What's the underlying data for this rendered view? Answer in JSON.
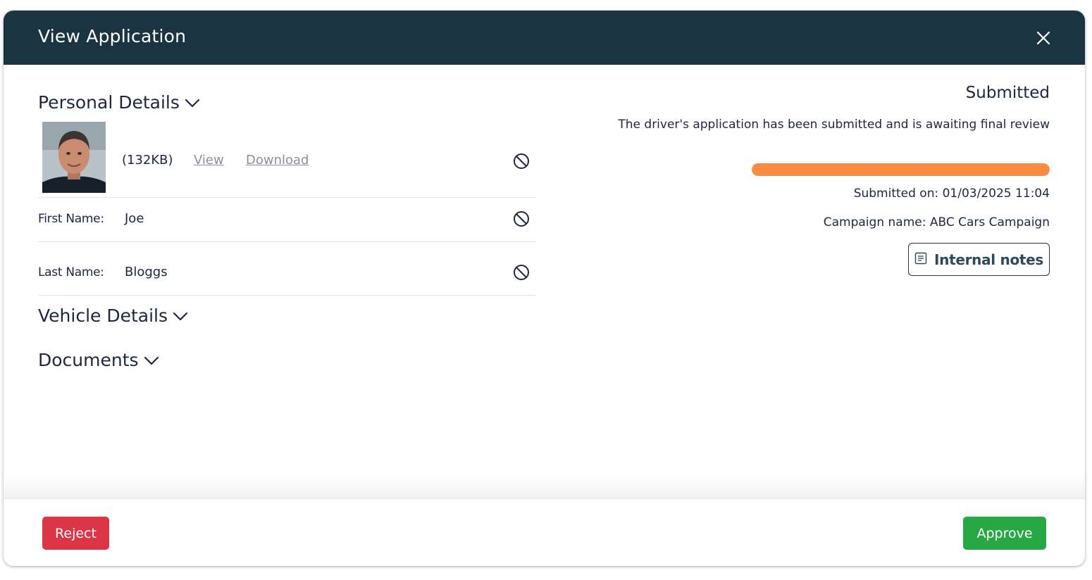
{
  "modal": {
    "title": "View Application"
  },
  "personal": {
    "heading": "Personal Details",
    "photo": {
      "size": "(132KB)",
      "view_label": "View",
      "download_label": "Download"
    },
    "fields": [
      {
        "label": "First Name:",
        "value": "Joe"
      },
      {
        "label": "Last Name:",
        "value": "Bloggs"
      }
    ]
  },
  "vehicle": {
    "heading": "Vehicle Details"
  },
  "documents": {
    "heading": "Documents"
  },
  "status": {
    "title": "Submitted",
    "description": "The driver's application has been submitted and is awaiting final review",
    "progress_percent": 100,
    "progress_color": "#f78d45",
    "submitted_on": "Submitted on: 01/03/2025 11:04",
    "campaign": "Campaign name: ABC Cars Campaign",
    "notes_label": "Internal notes"
  },
  "footer": {
    "reject_label": "Reject",
    "approve_label": "Approve"
  },
  "colors": {
    "header_bg": "#1b3441",
    "reject": "#dc3545",
    "approve": "#28a745"
  },
  "icons": [
    "close-icon",
    "chevron-down-icon",
    "ban-icon",
    "note-icon"
  ]
}
